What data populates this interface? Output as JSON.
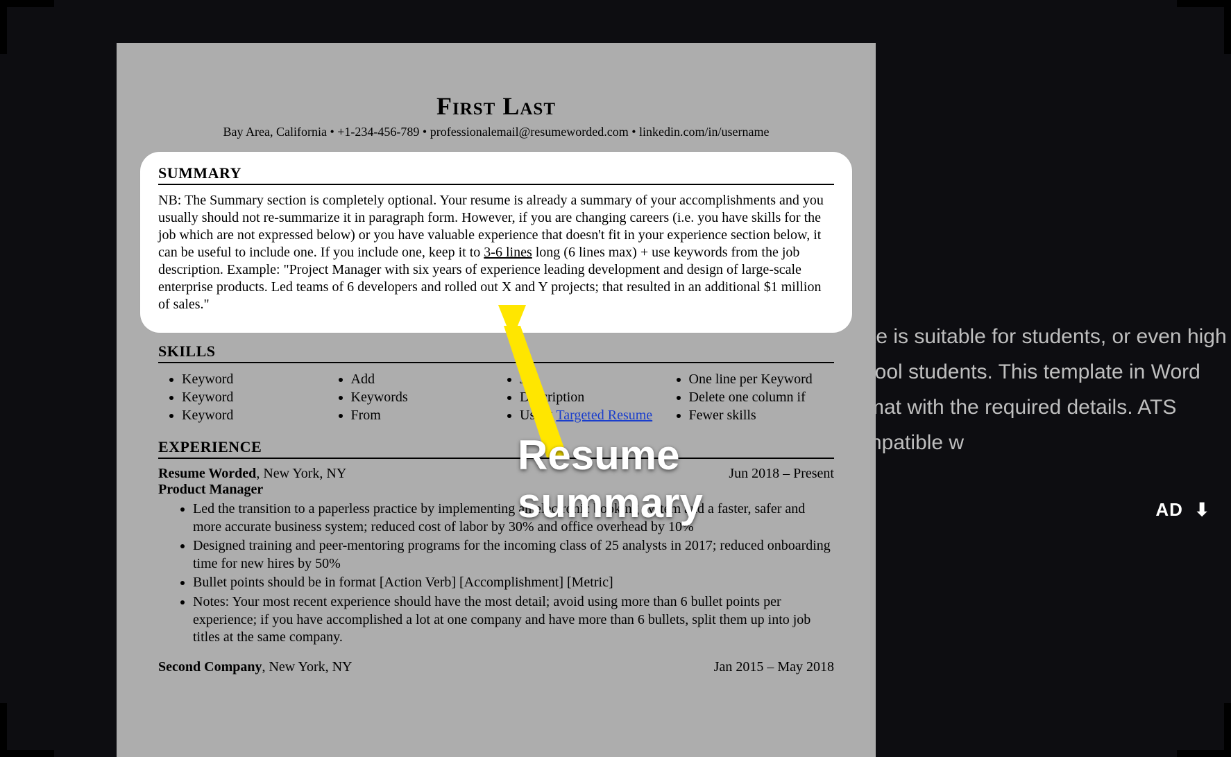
{
  "resume": {
    "name": "First Last",
    "contact": "Bay Area, California • +1-234-456-789 • professionalemail@resumeworded.com • linkedin.com/in/username",
    "summary_heading": "SUMMARY",
    "summary_pre": "NB: The Summary section is completely optional. Your resume is already a summary of your accomplishments and you usually should not re-summarize it in paragraph form. However, if you are changing careers (i.e. you have skills for the job which are not expressed below) or you have valuable experience that doesn't fit in your experience section below, it can be useful to include one. If you include one, keep it to ",
    "summary_underline": "3-6 lines",
    "summary_post": " long (6 lines max) + use keywords from the job description. Example: \"Project Manager with six years of experience leading development and design of large-scale enterprise products. Led teams of 6 developers and rolled out X and Y projects; that resulted in an additional $1 million of sales.\"",
    "skills_heading": "SKILLS",
    "skills": {
      "col1": [
        "Keyword",
        "Keyword",
        "Keyword"
      ],
      "col2": [
        "Add",
        "Keywords",
        "From"
      ],
      "col3_a": "Job",
      "col3_b": "Description",
      "col3_c_pre": "Using ",
      "col3_c_link": "Targeted Resume",
      "col4": [
        "One line per Keyword",
        "Delete one column if",
        "Fewer skills"
      ]
    },
    "experience_heading": "EXPERIENCE",
    "exp1": {
      "company": "Resume Worded",
      "location": ", New York, NY",
      "dates": "Jun 2018 – Present",
      "title": "Product Manager",
      "bullets": [
        "Led the transition to a paperless practice by implementing an electronic booking system and a faster, safer and more accurate business system; reduced cost of labor by 30% and office overhead by 10%",
        "Designed training and peer-mentoring programs for the incoming class of 25 analysts in 2017; reduced onboarding time for new hires by 50%",
        "Bullet points should be in format [Action Verb] [Accomplishment] [Metric]",
        "Notes: Your most recent experience should have the most detail; avoid using more than 6 bullet points per experience; if you have accomplished a lot at one company and have more than 6 bullets, split them up into job titles at the same company."
      ]
    },
    "exp2": {
      "company": "Second Company",
      "location": ", New York, NY",
      "dates": "Jan 2015 – May 2018"
    }
  },
  "callout": "Resume summary",
  "backdrop_desc": "plate is suitable for students, or even high school students. This template in Word format with the required details. ATS compatible w",
  "download_label": "AD"
}
